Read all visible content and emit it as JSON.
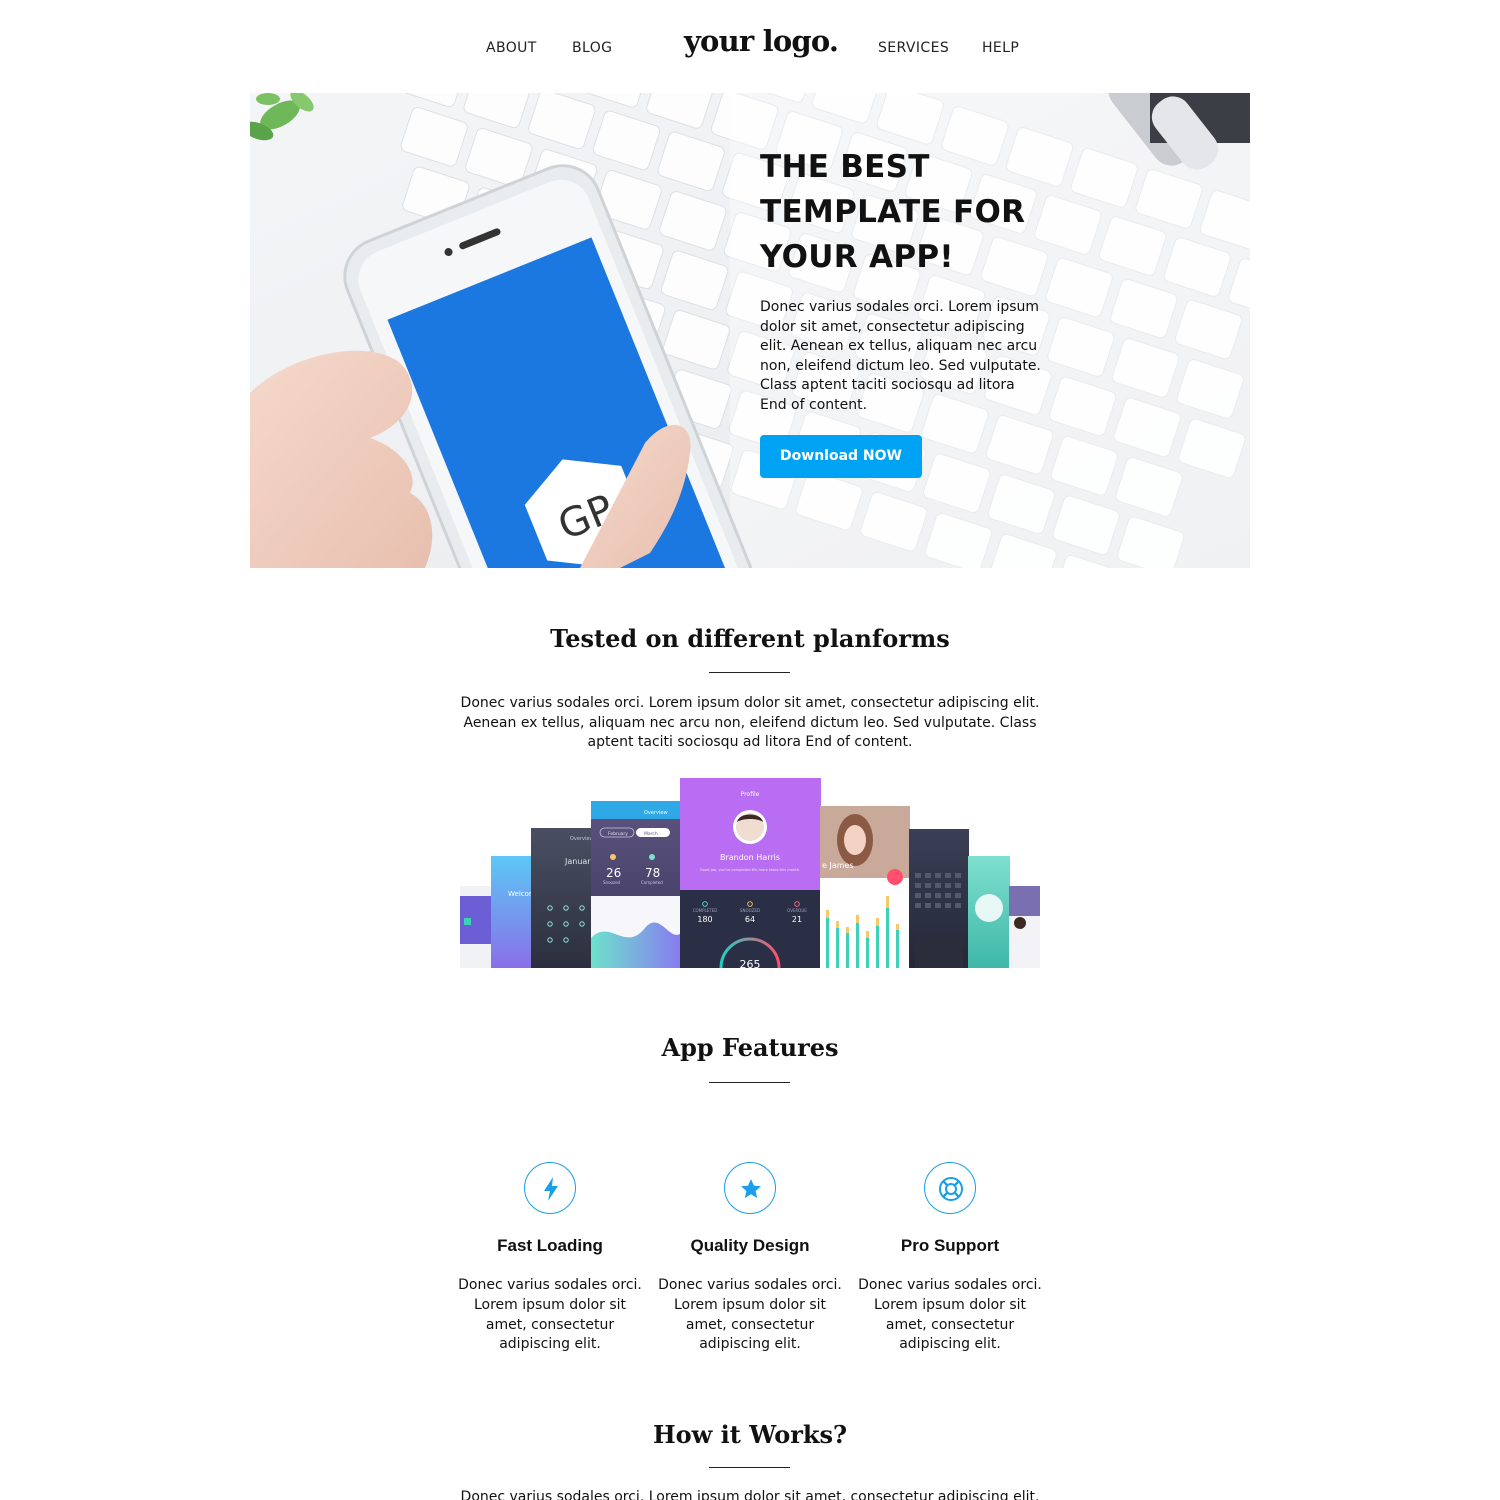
{
  "nav": {
    "about": "ABOUT",
    "blog": "BLOG",
    "logo": "your logo.",
    "services": "SERVICES",
    "help": "HELP"
  },
  "hero": {
    "title": "THE BEST TEMPLATE FOR YOUR APP!",
    "text": "Donec varius sodales orci. Lorem ipsum dolor sit amet, consectetur adipiscing elit. Aenean ex tellus, aliquam nec arcu non, eleifend dictum leo. Sed vulputate. Class aptent taciti sociosqu ad litora End of content.",
    "button": "Download NOW",
    "phone_badge": "GP",
    "accent_color": "#00a2f4"
  },
  "platforms": {
    "title": "Tested on different planforms",
    "text": "Donec varius sodales orci. Lorem ipsum dolor sit amet, consectetur adipiscing elit. Aenean ex tellus, aliquam nec arcu non, eleifend dictum leo. Sed vulputate. Class aptent taciti sociosqu ad litora End of content.",
    "screens": {
      "overview": "Overview",
      "month_feb": "February",
      "month_mar": "March",
      "stat_a": "26",
      "stat_b": "78",
      "stat_a_label": "Snoozed",
      "stat_b_label": "Completed",
      "profile": "Profile",
      "profile_name": "Brandon Harris",
      "profile_sub": "Good job, you've completed 6% more tasks this month.",
      "completed_label": "COMPLETED",
      "snoozed_label": "SNOOZED",
      "overdue_label": "OVERDUE",
      "completed": "180",
      "snoozed": "64",
      "overdue": "21",
      "gauge": "265",
      "photo_name": "e James",
      "welcome": "Welcom",
      "january": "Januar"
    }
  },
  "features": {
    "title": "App Features",
    "items": [
      {
        "icon": "lightning-icon",
        "title": "Fast Loading",
        "text": "Donec varius sodales orci. Lorem ipsum dolor sit amet, consectetur adipiscing elit."
      },
      {
        "icon": "star-icon",
        "title": "Quality Design",
        "text": "Donec varius sodales orci. Lorem ipsum dolor sit amet, consectetur adipiscing elit."
      },
      {
        "icon": "lifebuoy-icon",
        "title": "Pro Support",
        "text": "Donec varius sodales orci. Lorem ipsum dolor sit amet, consectetur adipiscing elit."
      }
    ]
  },
  "how": {
    "title": "How it Works?",
    "text": "Donec varius sodales orci. Lorem ipsum dolor sit amet, consectetur adipiscing elit."
  }
}
